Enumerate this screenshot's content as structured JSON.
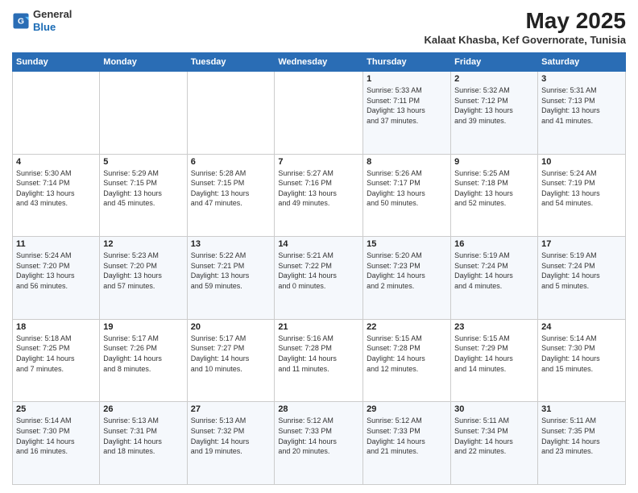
{
  "logo": {
    "general": "General",
    "blue": "Blue"
  },
  "title": "May 2025",
  "subtitle": "Kalaat Khasba, Kef Governorate, Tunisia",
  "headers": [
    "Sunday",
    "Monday",
    "Tuesday",
    "Wednesday",
    "Thursday",
    "Friday",
    "Saturday"
  ],
  "weeks": [
    [
      {
        "day": "",
        "info": ""
      },
      {
        "day": "",
        "info": ""
      },
      {
        "day": "",
        "info": ""
      },
      {
        "day": "",
        "info": ""
      },
      {
        "day": "1",
        "info": "Sunrise: 5:33 AM\nSunset: 7:11 PM\nDaylight: 13 hours\nand 37 minutes."
      },
      {
        "day": "2",
        "info": "Sunrise: 5:32 AM\nSunset: 7:12 PM\nDaylight: 13 hours\nand 39 minutes."
      },
      {
        "day": "3",
        "info": "Sunrise: 5:31 AM\nSunset: 7:13 PM\nDaylight: 13 hours\nand 41 minutes."
      }
    ],
    [
      {
        "day": "4",
        "info": "Sunrise: 5:30 AM\nSunset: 7:14 PM\nDaylight: 13 hours\nand 43 minutes."
      },
      {
        "day": "5",
        "info": "Sunrise: 5:29 AM\nSunset: 7:15 PM\nDaylight: 13 hours\nand 45 minutes."
      },
      {
        "day": "6",
        "info": "Sunrise: 5:28 AM\nSunset: 7:15 PM\nDaylight: 13 hours\nand 47 minutes."
      },
      {
        "day": "7",
        "info": "Sunrise: 5:27 AM\nSunset: 7:16 PM\nDaylight: 13 hours\nand 49 minutes."
      },
      {
        "day": "8",
        "info": "Sunrise: 5:26 AM\nSunset: 7:17 PM\nDaylight: 13 hours\nand 50 minutes."
      },
      {
        "day": "9",
        "info": "Sunrise: 5:25 AM\nSunset: 7:18 PM\nDaylight: 13 hours\nand 52 minutes."
      },
      {
        "day": "10",
        "info": "Sunrise: 5:24 AM\nSunset: 7:19 PM\nDaylight: 13 hours\nand 54 minutes."
      }
    ],
    [
      {
        "day": "11",
        "info": "Sunrise: 5:24 AM\nSunset: 7:20 PM\nDaylight: 13 hours\nand 56 minutes."
      },
      {
        "day": "12",
        "info": "Sunrise: 5:23 AM\nSunset: 7:20 PM\nDaylight: 13 hours\nand 57 minutes."
      },
      {
        "day": "13",
        "info": "Sunrise: 5:22 AM\nSunset: 7:21 PM\nDaylight: 13 hours\nand 59 minutes."
      },
      {
        "day": "14",
        "info": "Sunrise: 5:21 AM\nSunset: 7:22 PM\nDaylight: 14 hours\nand 0 minutes."
      },
      {
        "day": "15",
        "info": "Sunrise: 5:20 AM\nSunset: 7:23 PM\nDaylight: 14 hours\nand 2 minutes."
      },
      {
        "day": "16",
        "info": "Sunrise: 5:19 AM\nSunset: 7:24 PM\nDaylight: 14 hours\nand 4 minutes."
      },
      {
        "day": "17",
        "info": "Sunrise: 5:19 AM\nSunset: 7:24 PM\nDaylight: 14 hours\nand 5 minutes."
      }
    ],
    [
      {
        "day": "18",
        "info": "Sunrise: 5:18 AM\nSunset: 7:25 PM\nDaylight: 14 hours\nand 7 minutes."
      },
      {
        "day": "19",
        "info": "Sunrise: 5:17 AM\nSunset: 7:26 PM\nDaylight: 14 hours\nand 8 minutes."
      },
      {
        "day": "20",
        "info": "Sunrise: 5:17 AM\nSunset: 7:27 PM\nDaylight: 14 hours\nand 10 minutes."
      },
      {
        "day": "21",
        "info": "Sunrise: 5:16 AM\nSunset: 7:28 PM\nDaylight: 14 hours\nand 11 minutes."
      },
      {
        "day": "22",
        "info": "Sunrise: 5:15 AM\nSunset: 7:28 PM\nDaylight: 14 hours\nand 12 minutes."
      },
      {
        "day": "23",
        "info": "Sunrise: 5:15 AM\nSunset: 7:29 PM\nDaylight: 14 hours\nand 14 minutes."
      },
      {
        "day": "24",
        "info": "Sunrise: 5:14 AM\nSunset: 7:30 PM\nDaylight: 14 hours\nand 15 minutes."
      }
    ],
    [
      {
        "day": "25",
        "info": "Sunrise: 5:14 AM\nSunset: 7:30 PM\nDaylight: 14 hours\nand 16 minutes."
      },
      {
        "day": "26",
        "info": "Sunrise: 5:13 AM\nSunset: 7:31 PM\nDaylight: 14 hours\nand 18 minutes."
      },
      {
        "day": "27",
        "info": "Sunrise: 5:13 AM\nSunset: 7:32 PM\nDaylight: 14 hours\nand 19 minutes."
      },
      {
        "day": "28",
        "info": "Sunrise: 5:12 AM\nSunset: 7:33 PM\nDaylight: 14 hours\nand 20 minutes."
      },
      {
        "day": "29",
        "info": "Sunrise: 5:12 AM\nSunset: 7:33 PM\nDaylight: 14 hours\nand 21 minutes."
      },
      {
        "day": "30",
        "info": "Sunrise: 5:11 AM\nSunset: 7:34 PM\nDaylight: 14 hours\nand 22 minutes."
      },
      {
        "day": "31",
        "info": "Sunrise: 5:11 AM\nSunset: 7:35 PM\nDaylight: 14 hours\nand 23 minutes."
      }
    ]
  ]
}
